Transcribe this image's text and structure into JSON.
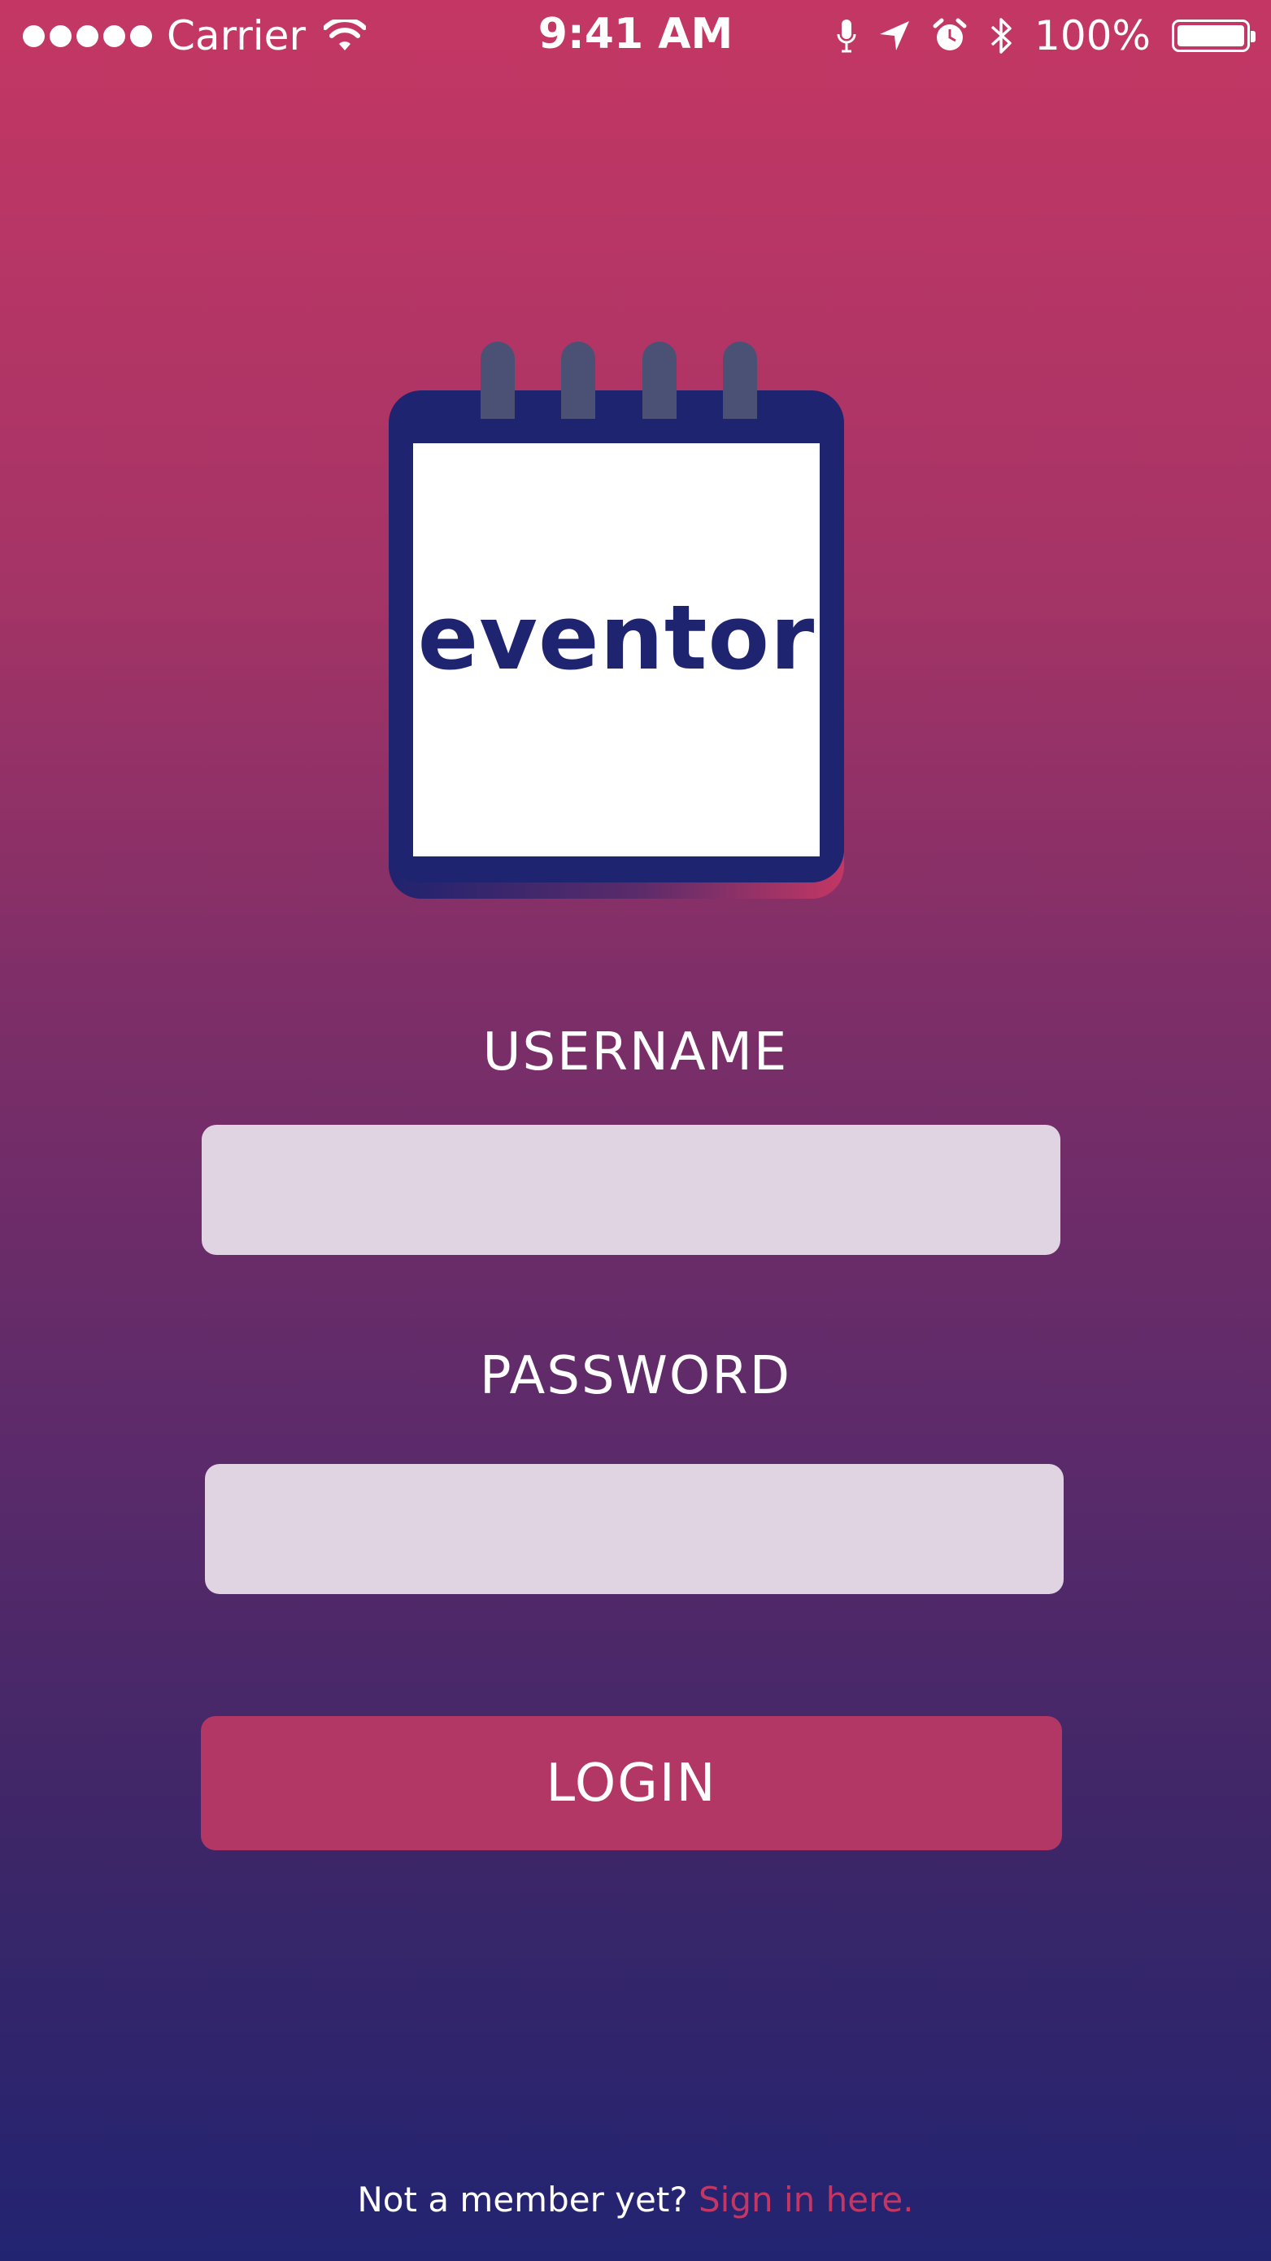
{
  "status_bar": {
    "carrier": "Carrier",
    "time": "9:41 AM",
    "battery": "100%",
    "battery_level": 1.0,
    "icons": [
      "signal-dots-icon",
      "wifi-icon",
      "microphone-icon",
      "location-arrow-icon",
      "alarm-clock-icon",
      "bluetooth-icon",
      "battery-icon"
    ]
  },
  "logo": {
    "text": "eventor",
    "colors": {
      "frame": "#1f2470",
      "rings": "#4a5175",
      "paper": "#ffffff"
    }
  },
  "form": {
    "username_label": "USERNAME",
    "username_value": "",
    "password_label": "PASSWORD",
    "password_value": "",
    "login_label": "LOGIN"
  },
  "footer": {
    "prompt": "Not a member yet?",
    "link": "Sign in here."
  },
  "colors": {
    "gradient_top": "#c43764",
    "gradient_bottom": "#222472",
    "accent": "#c33764",
    "button": "#b33765",
    "input_background": "#e0d4e2"
  }
}
